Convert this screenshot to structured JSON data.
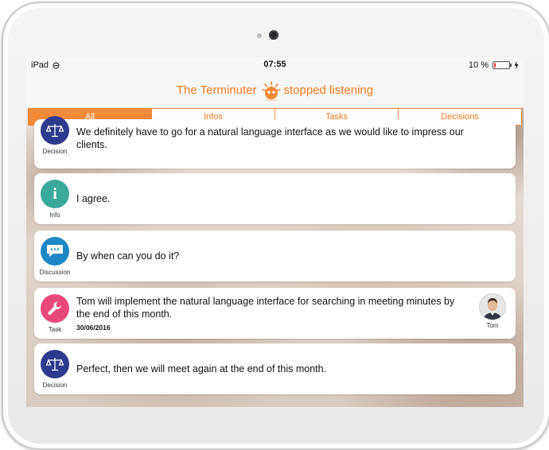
{
  "status_bar": {
    "device": "iPad",
    "time": "07:55",
    "battery": "10 %",
    "battery_level": 0.1
  },
  "header": {
    "title_left": "The Terminuter",
    "title_right": "stopped listening"
  },
  "tabs": [
    {
      "label": "All",
      "active": true
    },
    {
      "label": "Infos",
      "active": false
    },
    {
      "label": "Tasks",
      "active": false
    },
    {
      "label": "Decisions",
      "active": false
    }
  ],
  "messages": [
    {
      "type": "Decision",
      "icon": "scales-icon",
      "text": "We definitely have to go for a natural language interface as we would like to impress our clients."
    },
    {
      "type": "Info",
      "icon": "info-icon",
      "text": "I agree."
    },
    {
      "type": "Discussion",
      "icon": "speech-bubble-icon",
      "text": "By when can you do it?"
    },
    {
      "type": "Task",
      "icon": "wrench-icon",
      "text": "Tom will implement the natural language interface for searching in meeting minutes by the end of this month.",
      "date": "30/06/2016",
      "assignee": "Tom"
    },
    {
      "type": "Decision",
      "icon": "scales-icon",
      "text": "Perfect, then we will meet again at the end of this month."
    }
  ],
  "colors": {
    "accent": "#f28a3a",
    "decision": "#2e3a8c",
    "info": "#3aa99a",
    "discussion": "#1e88c7",
    "task": "#e8497a"
  }
}
